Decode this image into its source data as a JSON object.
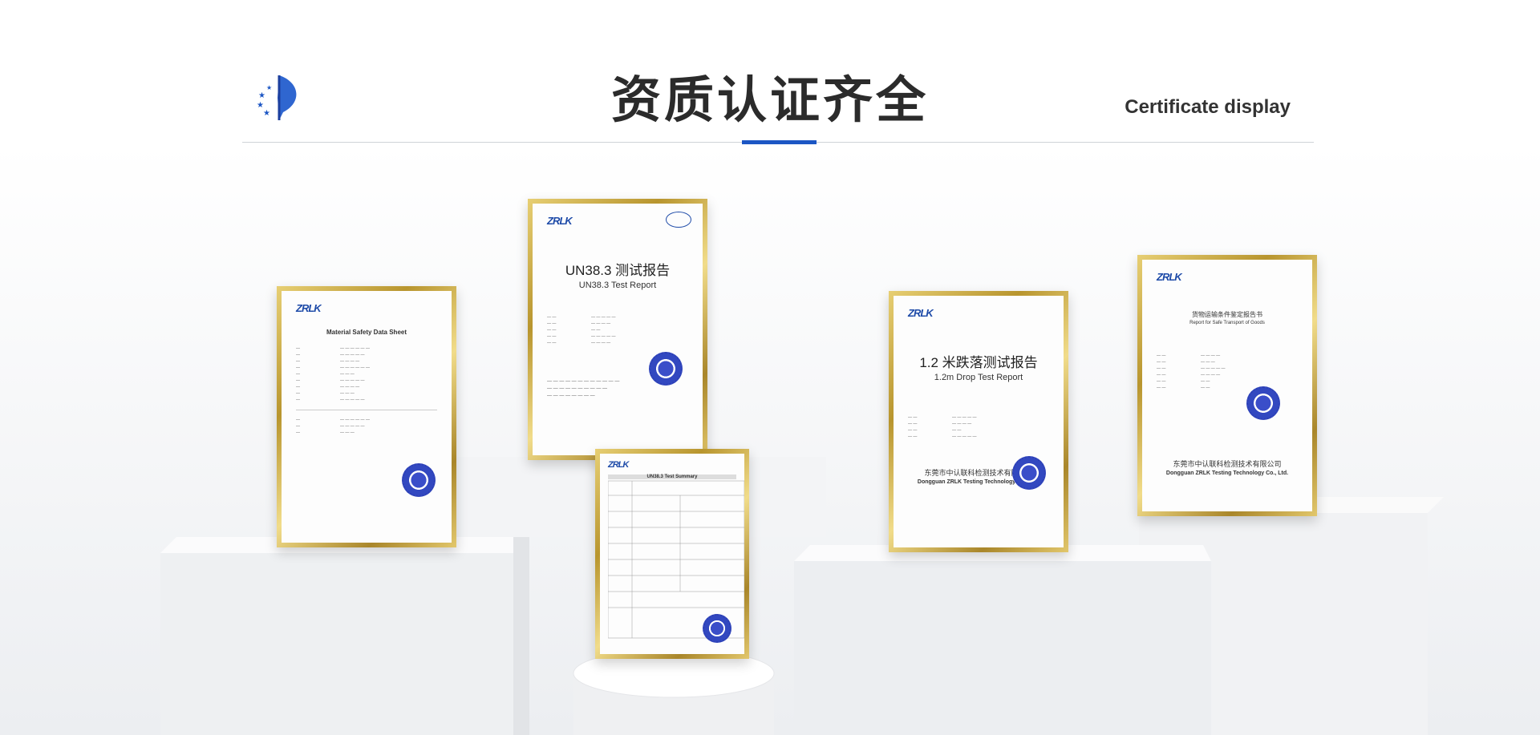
{
  "header": {
    "title": "资质认证齐全",
    "subtitle": "Certificate display"
  },
  "colors": {
    "accent": "#1c56c4",
    "frame_gold": "#c9a744",
    "text_dark": "#2b2b2b"
  },
  "certificates": [
    {
      "brand": "ZRLK",
      "title": "Material Safety Data Sheet",
      "subtitle": "",
      "org": ""
    },
    {
      "brand": "ZRLK",
      "title": "UN38.3 测试报告",
      "subtitle": "UN38.3 Test Report",
      "org": ""
    },
    {
      "brand": "ZRLK",
      "title": "UN38.3 Test Summary",
      "subtitle": "",
      "org": ""
    },
    {
      "brand": "ZRLK",
      "title": "1.2 米跌落测试报告",
      "subtitle": "1.2m Drop Test Report",
      "org": "东莞市中认联科检测技术有限公司",
      "org_en": "Dongguan ZRLK Testing Technology Co., Ltd."
    },
    {
      "brand": "ZRLK",
      "title": "货物运输条件鉴定报告书",
      "subtitle": "Report for Safe Transport of Goods",
      "org": "东莞市中认联科检测技术有限公司",
      "org_en": "Dongguan ZRLK Testing Technology Co., Ltd."
    }
  ]
}
